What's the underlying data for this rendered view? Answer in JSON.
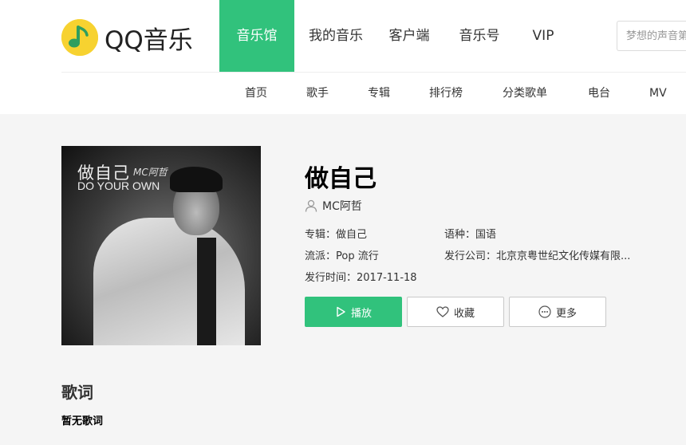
{
  "header": {
    "logo_text": "QQ音乐",
    "nav": [
      {
        "label": "音乐馆",
        "active": true
      },
      {
        "label": "我的音乐"
      },
      {
        "label": "客户端"
      },
      {
        "label": "音乐号"
      },
      {
        "label": "VIP"
      }
    ],
    "search_placeholder": "梦想的声音第",
    "sub_nav": [
      "首页",
      "歌手",
      "专辑",
      "排行榜",
      "分类歌单",
      "电台",
      "MV"
    ]
  },
  "colors": {
    "accent": "#31c27c",
    "logo": "#f7d230"
  },
  "cover": {
    "title": "做自己",
    "signature": "MC阿哲",
    "subtitle": "DO YOUR OWN"
  },
  "song": {
    "title": "做自己",
    "singer": "MC阿哲",
    "album_label": "专辑：做自己",
    "language_label": "语种：国语",
    "genre_label": "流派：Pop 流行",
    "company_label": "发行公司：北京京粤世纪文化传媒有限...",
    "release_label": "发行时间：2017-11-18"
  },
  "actions": {
    "play": "播放",
    "favorite": "收藏",
    "more": "更多"
  },
  "lyrics": {
    "heading": "歌词",
    "empty": "暂无歌词"
  }
}
